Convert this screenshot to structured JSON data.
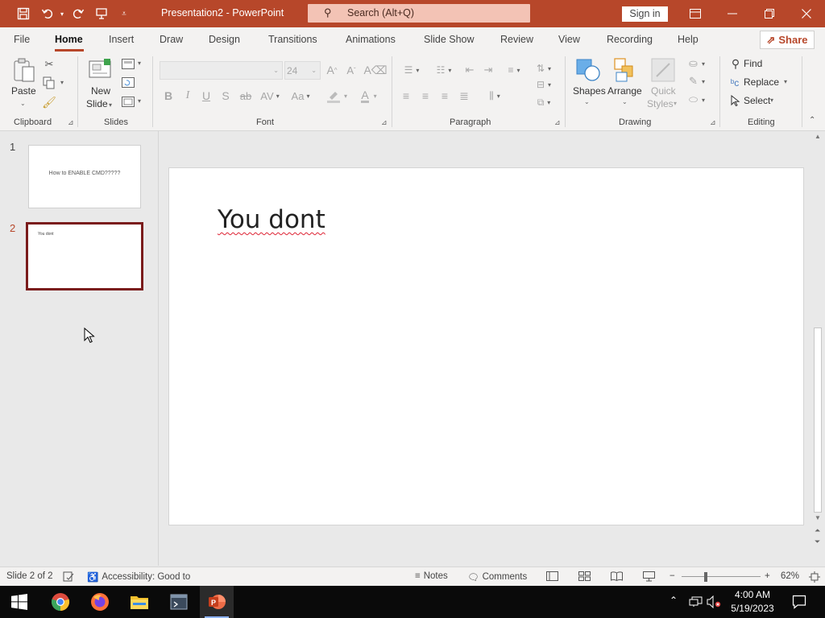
{
  "window": {
    "document_title": "Presentation2  -  PowerPoint",
    "search_placeholder": "Search (Alt+Q)",
    "signin_label": "Sign in",
    "accent_color": "#b7472a"
  },
  "tabs": [
    {
      "label": "File"
    },
    {
      "label": "Home"
    },
    {
      "label": "Insert"
    },
    {
      "label": "Draw"
    },
    {
      "label": "Design"
    },
    {
      "label": "Transitions"
    },
    {
      "label": "Animations"
    },
    {
      "label": "Slide Show"
    },
    {
      "label": "Review"
    },
    {
      "label": "View"
    },
    {
      "label": "Recording"
    },
    {
      "label": "Help"
    }
  ],
  "active_tab": "Home",
  "share_label": "Share",
  "ribbon": {
    "clipboard": {
      "group_label": "Clipboard",
      "paste_label": "Paste"
    },
    "slides": {
      "group_label": "Slides",
      "new_slide_line1": "New",
      "new_slide_line2": "Slide"
    },
    "font": {
      "group_label": "Font",
      "font_size": "24"
    },
    "paragraph": {
      "group_label": "Paragraph"
    },
    "drawing": {
      "group_label": "Drawing",
      "shapes_label": "Shapes",
      "arrange_label": "Arrange",
      "quick_line1": "Quick",
      "quick_line2": "Styles"
    },
    "editing": {
      "group_label": "Editing",
      "find_label": "Find",
      "replace_label": "Replace",
      "select_label": "Select"
    }
  },
  "slides": [
    {
      "number": "1",
      "thumb_text": "How to ENABLE CMD?????",
      "selected": false
    },
    {
      "number": "2",
      "thumb_text": "You dont",
      "selected": true
    }
  ],
  "current_slide": {
    "title": "You dont"
  },
  "status": {
    "slide_info": "Slide 2 of 2",
    "accessibility": "Accessibility: Good to",
    "notes_label": "Notes",
    "comments_label": "Comments",
    "zoom": "62%",
    "zoom_level": 0.62
  },
  "taskbar": {
    "time": "4:00 AM",
    "date": "5/19/2023"
  }
}
